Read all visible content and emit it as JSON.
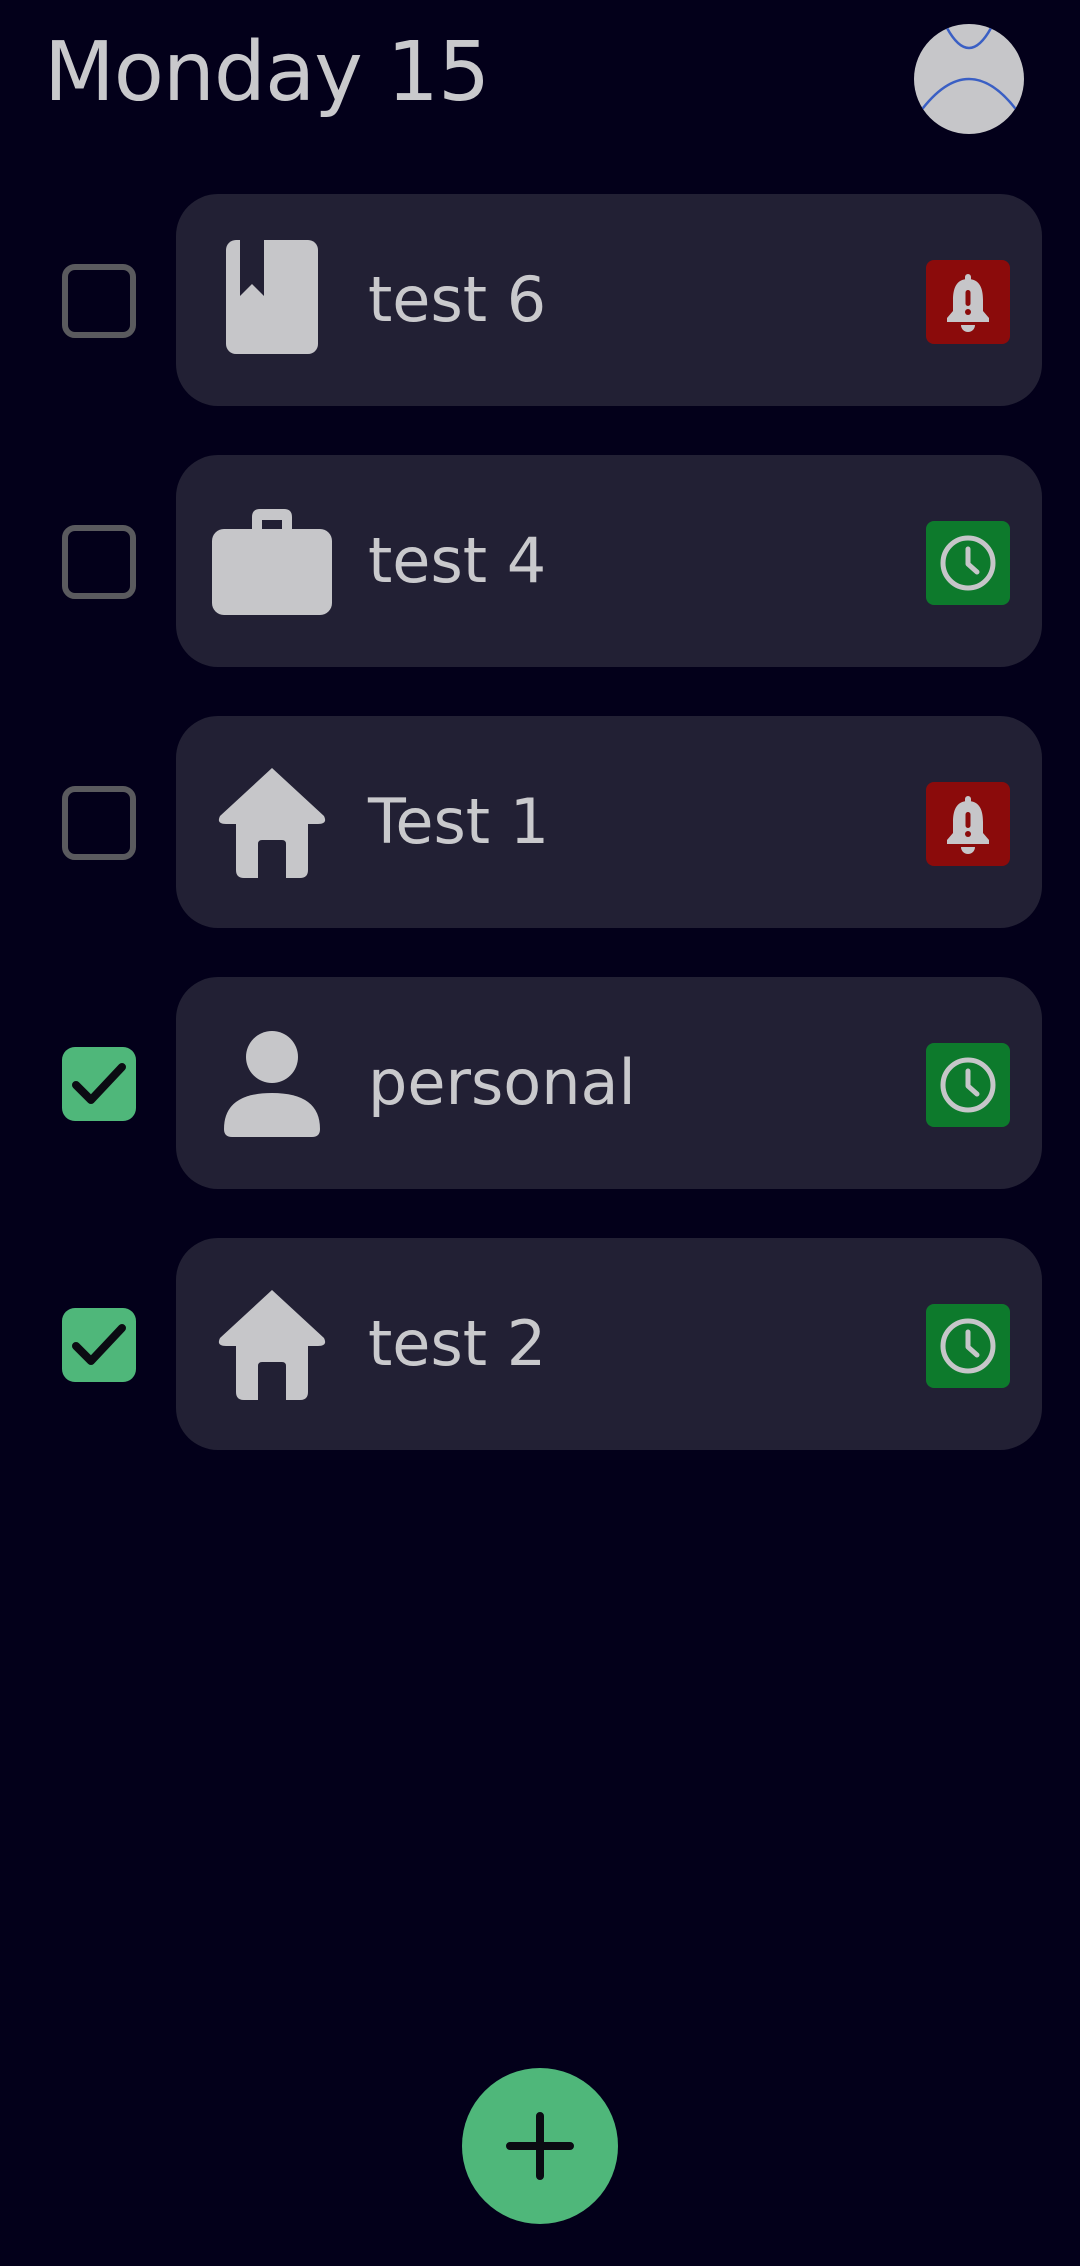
{
  "header": {
    "date_title": "Monday 15"
  },
  "theme": {
    "background": "#03001a",
    "card": "#222034",
    "text": "#c9c9cc",
    "accent_green": "#4fb77a",
    "alarm_red": "#8b0b0b",
    "reminder_green": "#0d7a2c"
  },
  "tasks": [
    {
      "label": "test 6",
      "checked": false,
      "category_icon": "bookmark-book-icon",
      "badge": "bell-icon"
    },
    {
      "label": "test 4",
      "checked": false,
      "category_icon": "briefcase-icon",
      "badge": "clock-icon"
    },
    {
      "label": "Test 1",
      "checked": false,
      "category_icon": "home-icon",
      "badge": "bell-icon"
    },
    {
      "label": "personal",
      "checked": true,
      "category_icon": "person-icon",
      "badge": "clock-icon"
    },
    {
      "label": "test 2",
      "checked": true,
      "category_icon": "home-icon",
      "badge": "clock-icon"
    }
  ],
  "fab": {
    "icon": "plus-icon"
  }
}
